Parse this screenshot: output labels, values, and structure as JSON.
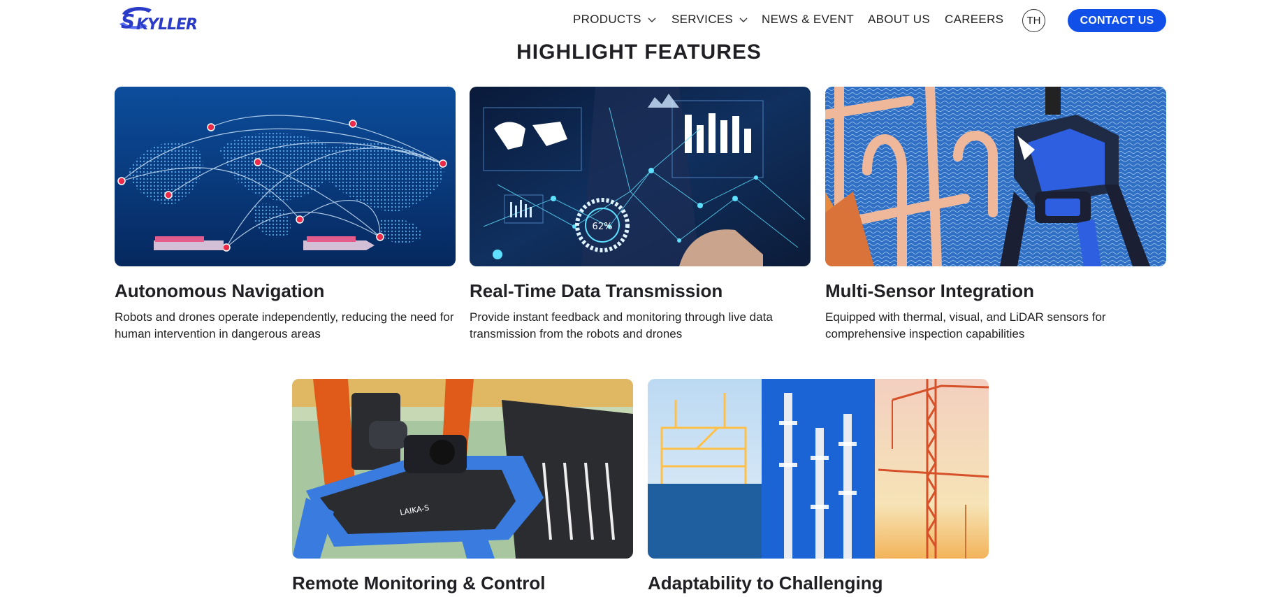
{
  "brand": {
    "logo_text": "SKYLLER",
    "color": "#2a3cc7"
  },
  "nav": {
    "items": [
      {
        "label": "PRODUCTS",
        "has_dropdown": true
      },
      {
        "label": "SERVICES",
        "has_dropdown": true
      },
      {
        "label": "NEWS & EVENT",
        "has_dropdown": false
      },
      {
        "label": "ABOUT US",
        "has_dropdown": false
      },
      {
        "label": "CAREERS",
        "has_dropdown": false
      }
    ],
    "language": "TH",
    "contact_label": "CONTACT US",
    "accent": "#1150e8"
  },
  "section": {
    "title": "HIGHLIGHT FEATURES",
    "cards": [
      {
        "title": "Autonomous Navigation",
        "description": "Robots and drones operate independently, reducing the need for human intervention in dangerous areas",
        "image": "world-map-routes"
      },
      {
        "title": "Real-Time Data Transmission",
        "description": "Provide instant feedback and monitoring through live data transmission from the robots and drones",
        "image": "data-dashboard",
        "image_text": "62%"
      },
      {
        "title": "Multi-Sensor Integration",
        "description": "Equipped with thermal, visual, and LiDAR sensors for comprehensive inspection capabilities",
        "image": "robot-dog-offshore"
      },
      {
        "title": "Remote Monitoring & Control",
        "description": "",
        "image": "robot-dog-closeup",
        "image_text": "LAIKA-S"
      },
      {
        "title": "Adaptability to Challenging",
        "description": "",
        "image": "industrial-collage"
      }
    ]
  }
}
